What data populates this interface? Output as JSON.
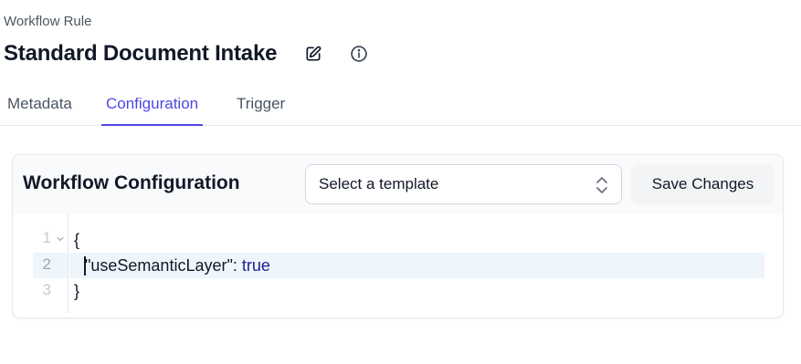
{
  "header": {
    "eyebrow": "Workflow Rule",
    "title": "Standard Document Intake"
  },
  "tabs": [
    {
      "label": "Metadata",
      "active": false
    },
    {
      "label": "Configuration",
      "active": true
    },
    {
      "label": "Trigger",
      "active": false
    }
  ],
  "card": {
    "title": "Workflow Configuration",
    "template_select": {
      "placeholder": "Select a template"
    },
    "save_label": "Save Changes"
  },
  "editor": {
    "lines": [
      {
        "number": "1",
        "text": "{"
      },
      {
        "number": "2",
        "key": "\"useSemanticLayer\"",
        "sep": ": ",
        "value": "true"
      },
      {
        "number": "3",
        "text": "}"
      }
    ]
  },
  "icons": [
    "edit-icon",
    "info-icon",
    "chevron-up-down-icon",
    "fold-chevron-icon"
  ],
  "colors": {
    "accent": "#4f46e5",
    "boolean_token": "#1c1c8f",
    "active_line": "#eef6fc"
  }
}
